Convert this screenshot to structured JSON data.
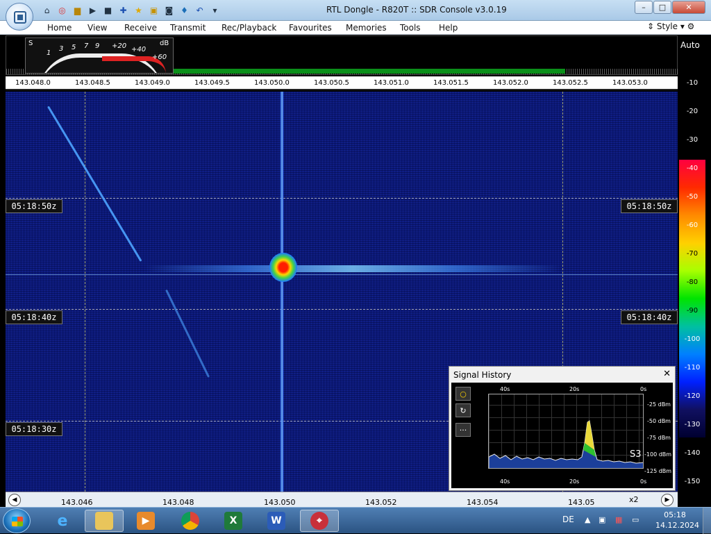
{
  "window": {
    "title": "RTL Dongle - R820T :: SDR Console v3.0.19",
    "min_label": "–",
    "max_label": "□",
    "close_label": "✕"
  },
  "qat_icons": [
    "home-icon",
    "lifebuoy-icon",
    "folder-icon",
    "play-icon",
    "stop-icon",
    "add-icon",
    "star-icon",
    "lock-icon",
    "camera-icon",
    "drop-icon",
    "undo-icon",
    "dropdown-icon"
  ],
  "menu": [
    "Home",
    "View",
    "Receive",
    "Transmit",
    "Rec/Playback",
    "Favourites",
    "Memories",
    "Tools",
    "Help"
  ],
  "style_label": "Style",
  "smeter": {
    "s_label": "S",
    "db_label": "dB",
    "scale": [
      "1",
      "3",
      "5",
      "7",
      "9",
      "+20",
      "+40",
      "+60"
    ]
  },
  "spectrum": {
    "auto_label": "Auto"
  },
  "freq_ticks": [
    "143.048.0",
    "143.048.5",
    "143.049.0",
    "143.049.5",
    "143.050.0",
    "143.050.5",
    "143.051.0",
    "143.051.5",
    "143.052.0",
    "143.052.5",
    "143.053.0"
  ],
  "timestamps": [
    "05:18:50z",
    "05:18:40z",
    "05:18:30z"
  ],
  "db_scale": [
    "-10",
    "-20",
    "-30",
    "-40",
    "-50",
    "-60",
    "-70",
    "-80",
    "-90",
    "-100",
    "-110",
    "-120",
    "-130",
    "-140",
    "-150"
  ],
  "signal_history": {
    "title": "Signal History",
    "close": "✕",
    "top_times": [
      "40s",
      "20s",
      "0s"
    ],
    "bottom_times": [
      "40s",
      "20s",
      "0s"
    ],
    "dbm_labels": [
      "-25 dBm",
      "-50 dBm",
      "-75 dBm",
      "-100 dBm",
      "-125 dBm"
    ],
    "s_reading": "S3",
    "buttons": [
      "○",
      "↻",
      "···"
    ]
  },
  "bottom_scale": [
    "143.046",
    "143.048",
    "143.050",
    "143.052",
    "143.054",
    "143.05"
  ],
  "bottom_zoom": "x2",
  "taskbar": {
    "apps": [
      "internet-explorer",
      "file-explorer",
      "media-player",
      "chrome",
      "excel",
      "word",
      "sdr-console"
    ],
    "language": "DE",
    "time": "05:18",
    "date": "14.12.2024"
  }
}
